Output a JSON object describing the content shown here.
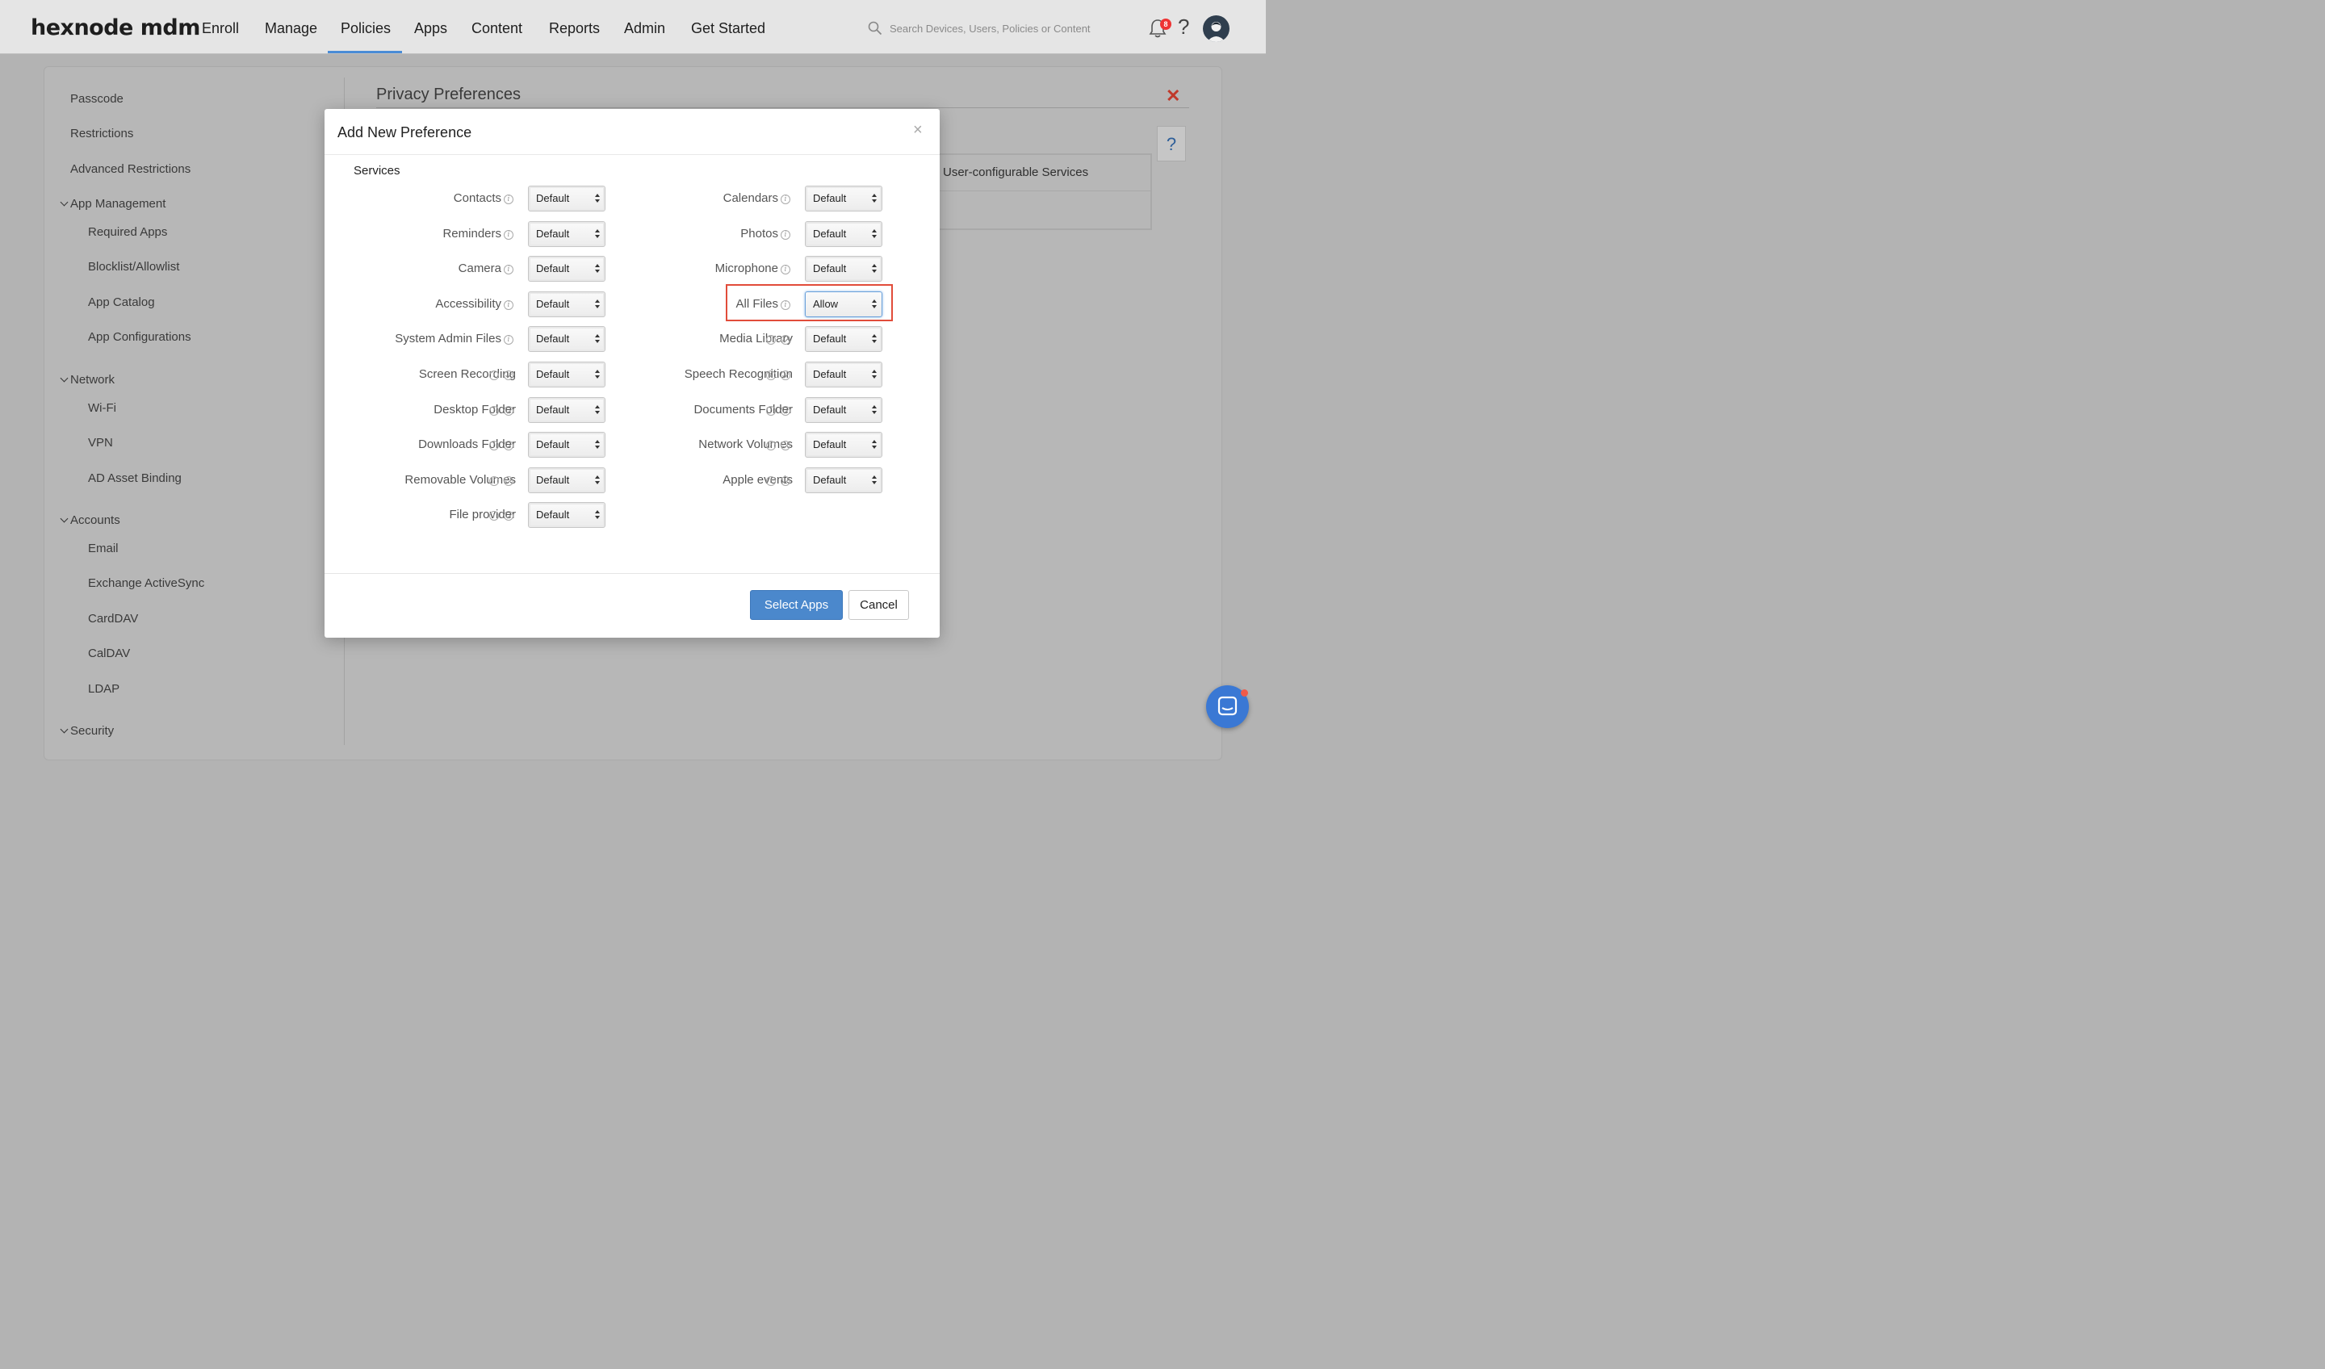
{
  "nav": {
    "logo": "hexnode mdm",
    "items": [
      "Enroll",
      "Manage",
      "Policies",
      "Apps",
      "Content",
      "Reports",
      "Admin",
      "Get Started"
    ],
    "active": "Policies",
    "search_placeholder": "Search Devices, Users, Policies or Content",
    "notification_count": "8",
    "help": "?"
  },
  "sidebar": {
    "items": [
      {
        "label": "Passcode"
      },
      {
        "label": "Restrictions"
      },
      {
        "label": "Advanced Restrictions"
      }
    ],
    "groups": [
      {
        "label": "App Management",
        "items": [
          "Required Apps",
          "Blocklist/Allowlist",
          "App Catalog",
          "App Configurations"
        ]
      },
      {
        "label": "Network",
        "items": [
          "Wi-Fi",
          "VPN",
          "AD Asset Binding"
        ]
      },
      {
        "label": "Accounts",
        "items": [
          "Email",
          "Exchange ActiveSync",
          "CardDAV",
          "CalDAV",
          "LDAP"
        ]
      },
      {
        "label": "Security",
        "items": []
      }
    ]
  },
  "section": {
    "title": "Privacy Preferences",
    "close": "✕",
    "help": "?",
    "table_header": "User-configurable Services"
  },
  "modal": {
    "title": "Add New Preference",
    "close": "×",
    "services_label": "Services",
    "left_services": [
      {
        "label": "Contacts",
        "value": "Default"
      },
      {
        "label": "Reminders",
        "value": "Default"
      },
      {
        "label": "Camera",
        "value": "Default"
      },
      {
        "label": "Accessibility",
        "value": "Default"
      },
      {
        "label": "System Admin Files",
        "value": "Default"
      },
      {
        "label": "Screen Recording",
        "value": "Default"
      },
      {
        "label": "Desktop Folder",
        "value": "Default"
      },
      {
        "label": "Downloads Folder",
        "value": "Default"
      },
      {
        "label": "Removable Volumes",
        "value": "Default"
      },
      {
        "label": "File provider",
        "value": "Default"
      }
    ],
    "right_services": [
      {
        "label": "Calendars",
        "value": "Default"
      },
      {
        "label": "Photos",
        "value": "Default"
      },
      {
        "label": "Microphone",
        "value": "Default"
      },
      {
        "label": "All Files",
        "value": "Allow"
      },
      {
        "label": "Media Library",
        "value": "Default"
      },
      {
        "label": "Speech Recognition",
        "value": "Default"
      },
      {
        "label": "Documents Folder",
        "value": "Default"
      },
      {
        "label": "Network Volumes",
        "value": "Default"
      },
      {
        "label": "Apple events",
        "value": "Default"
      }
    ],
    "primary_button": "Select Apps",
    "cancel_button": "Cancel"
  },
  "colors": {
    "accent": "#4b88cc",
    "highlight": "#e14c3a",
    "close_red": "#c0392b"
  }
}
